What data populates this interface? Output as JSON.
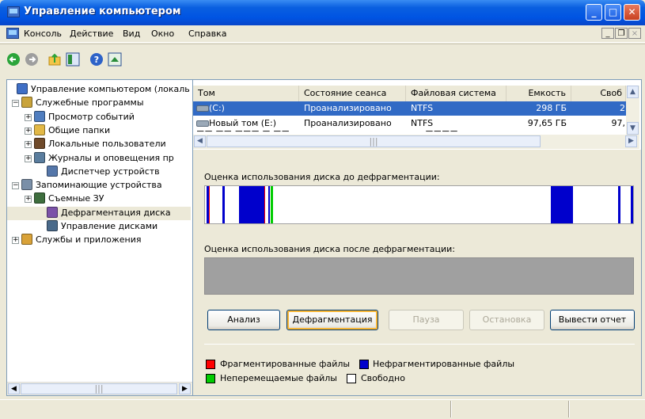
{
  "window": {
    "title": "Управление компьютером"
  },
  "menu": {
    "items": [
      "Консоль",
      "Действие",
      "Вид",
      "Окно",
      "Справка"
    ]
  },
  "mdi_controls": [
    "_",
    "&#x2750;",
    "×"
  ],
  "tree": {
    "items": [
      {
        "label": "Управление компьютером (локаль",
        "expander": ""
      },
      {
        "label": "Служебные программы",
        "expander": "−"
      },
      {
        "label": "Просмотр событий",
        "expander": "+"
      },
      {
        "label": "Общие папки",
        "expander": "+"
      },
      {
        "label": "Локальные пользователи",
        "expander": "+"
      },
      {
        "label": "Журналы и оповещения пр",
        "expander": "+"
      },
      {
        "label": "Диспетчер устройств",
        "expander": ""
      },
      {
        "label": "Запоминающие устройства",
        "expander": "−"
      },
      {
        "label": "Съемные ЗУ",
        "expander": "+"
      },
      {
        "label": "Дефрагментация диска",
        "expander": ""
      },
      {
        "label": "Управление дисками",
        "expander": ""
      },
      {
        "label": "Службы и приложения",
        "expander": "+"
      }
    ]
  },
  "volumes": {
    "columns": [
      "Том",
      "Состояние сеанса",
      "Файловая система",
      "Емкость",
      "Своб"
    ],
    "rows": [
      {
        "name": "(C:)",
        "status": "Проанализировано",
        "fs": "NTFS",
        "capacity": "298 ГБ",
        "free": "2"
      },
      {
        "name": "Новый том (E:)",
        "status": "Проанализировано",
        "fs": "NTFS",
        "capacity": "97,65 ГБ",
        "free": "97,"
      }
    ]
  },
  "defrag": {
    "before_label": "Оценка использования диска до дефрагментации:",
    "after_label": "Оценка использования диска после дефрагментации:",
    "buttons": {
      "analyze": "Анализ",
      "defragment": "Дефрагментация",
      "pause": "Пауза",
      "stop": "Остановка",
      "report": "Вывести отчет"
    },
    "legend": {
      "fragmented": "Фрагментированные файлы",
      "contiguous": "Нефрагментированные файлы",
      "unmovable": "Неперемещаемые файлы",
      "free": "Свободно"
    }
  },
  "colors": {
    "fragmented": "#FF0000",
    "contiguous": "#0000CC",
    "unmovable": "#00CC00",
    "free": "#FFFFFF",
    "title_blue": "#0054E3",
    "selection": "#316AC5"
  }
}
